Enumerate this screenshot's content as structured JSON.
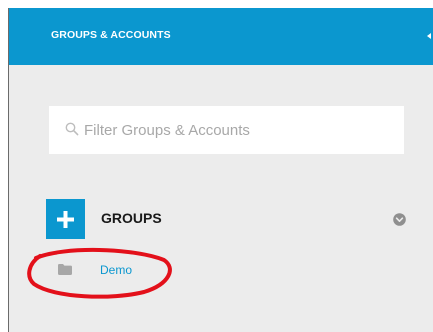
{
  "header": {
    "title": "GROUPS & ACCOUNTS",
    "background_color": "#0b97cf",
    "collapse_icon": "chevron-left-icon"
  },
  "filter": {
    "placeholder": "Filter Groups & Accounts",
    "value": "",
    "icon": "search-icon"
  },
  "groups": {
    "label": "GROUPS",
    "add_icon": "plus-icon",
    "toggle_icon": "chevron-down-icon",
    "items": [
      {
        "label": "Demo",
        "icon": "folder-icon"
      }
    ]
  },
  "annotation": {
    "color": "#e3101a",
    "shape": "ellipse"
  },
  "colors": {
    "accent": "#0b97cf",
    "panel": "#ececec",
    "link": "#0b97cf"
  }
}
